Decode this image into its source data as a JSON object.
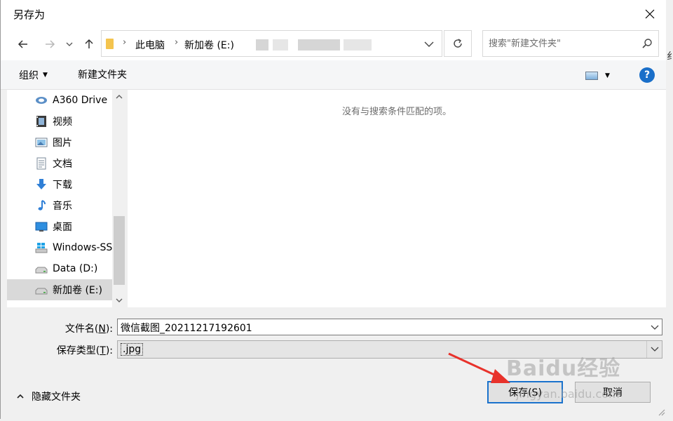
{
  "dialog": {
    "title": "另存为"
  },
  "address": {
    "crumbs": [
      "此电脑",
      "新加卷 (E:)"
    ]
  },
  "search": {
    "placeholder": "搜索\"新建文件夹\""
  },
  "toolbar": {
    "organize_label": "组织",
    "new_folder_label": "新建文件夹",
    "help_label": "?"
  },
  "sidebar": {
    "items": [
      {
        "label": "A360 Drive",
        "icon": "cloud-drive-icon"
      },
      {
        "label": "视频",
        "icon": "video-icon"
      },
      {
        "label": "图片",
        "icon": "picture-icon"
      },
      {
        "label": "文档",
        "icon": "document-icon"
      },
      {
        "label": "下载",
        "icon": "download-icon"
      },
      {
        "label": "音乐",
        "icon": "music-icon"
      },
      {
        "label": "桌面",
        "icon": "desktop-icon"
      },
      {
        "label": "Windows-SS",
        "icon": "windows-drive-icon"
      },
      {
        "label": "Data (D:)",
        "icon": "drive-icon"
      },
      {
        "label": "新加卷 (E:)",
        "icon": "drive-icon",
        "selected": true
      }
    ]
  },
  "content": {
    "empty_message": "没有与搜索条件匹配的项。"
  },
  "form": {
    "filename_label_pre": "文件名(",
    "filename_label_key": "N",
    "filename_label_post": "):",
    "filename_value": "微信截图_20211217192601",
    "filetype_label_pre": "保存类型(",
    "filetype_label_key": "T",
    "filetype_label_post": "):",
    "filetype_value": ".jpg",
    "hide_folders_label": "隐藏文件夹",
    "save_label": "保存(S)",
    "cancel_label": "取消"
  },
  "watermark": {
    "brand": "Baidu经验",
    "url": "jingyan.baidu.com"
  },
  "colors": {
    "accent": "#1a72cc",
    "arrow": "#e8322b",
    "selected_bg": "#d9d9d9"
  }
}
